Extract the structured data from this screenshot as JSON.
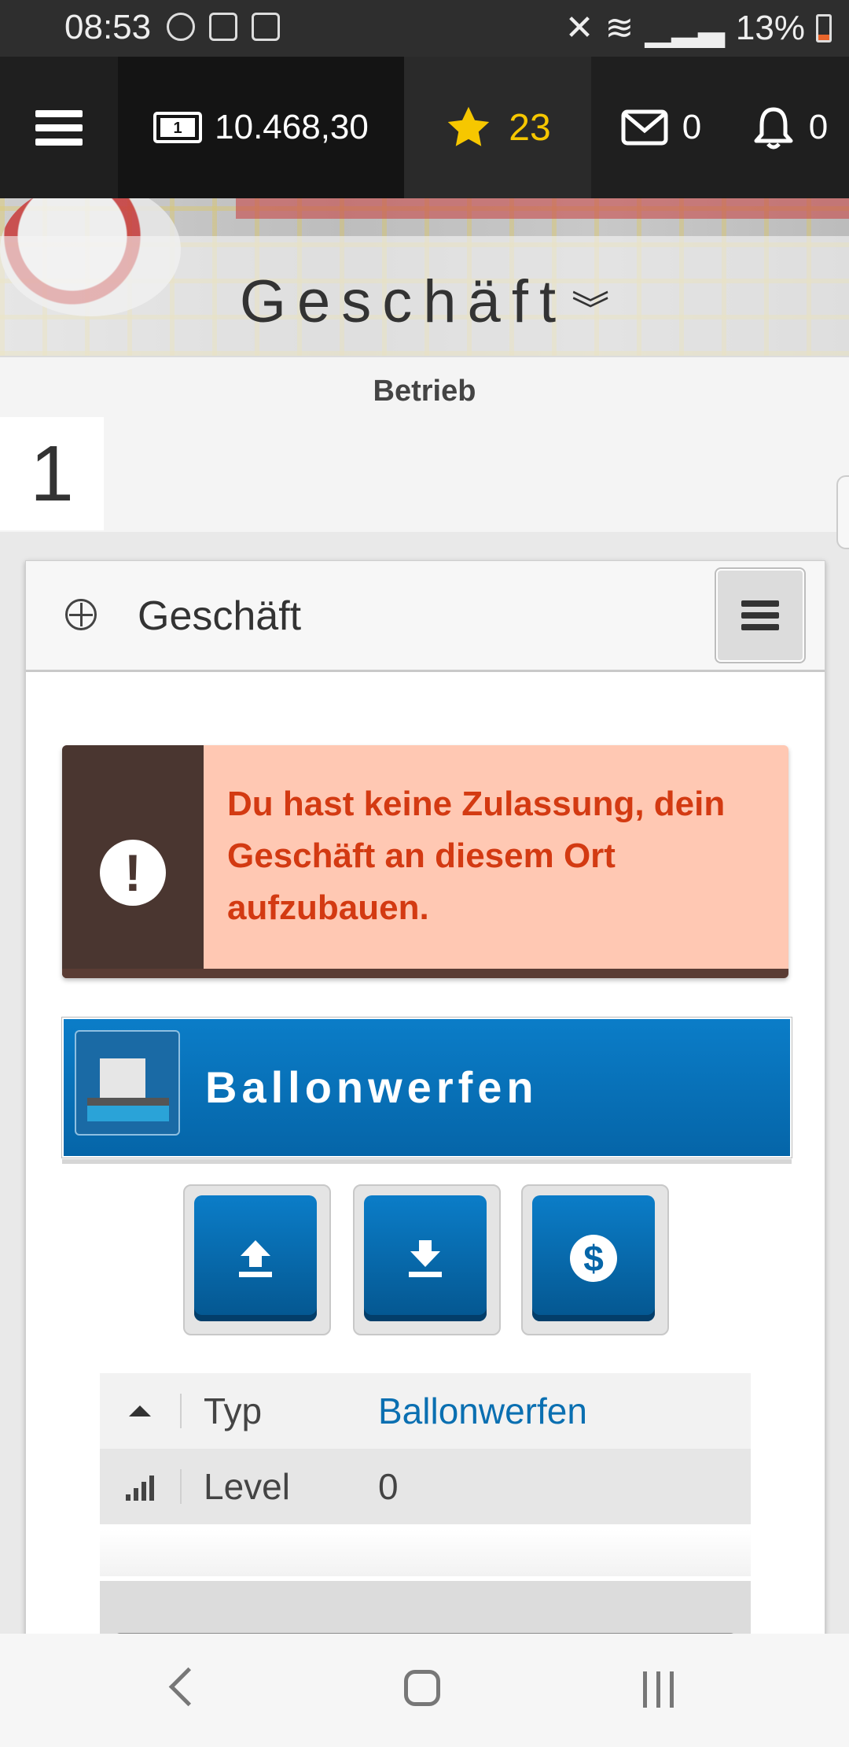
{
  "status_bar": {
    "time": "08:53",
    "battery": "13%",
    "icons": [
      "sync-icon",
      "screen-icon",
      "check-icon",
      "mute-icon",
      "wifi-icon",
      "signal-icon",
      "battery-icon"
    ]
  },
  "header": {
    "money": "10.468,30",
    "stars": "23",
    "messages": "0",
    "notifications": "0",
    "colors": {
      "background": "#1f1f1f",
      "star": "#f6c700"
    }
  },
  "banner": {
    "title": "Geschäft"
  },
  "subnav": {
    "label": "Betrieb",
    "number": "1"
  },
  "panel": {
    "title": "Geschäft",
    "alert": {
      "message": "Du hast keine Zulassung, dein Geschäft an diesem Ort aufzubauen.",
      "color": "#d33a12",
      "background": "#ffc8b3"
    },
    "business": {
      "name": "Ballonwerfen",
      "color": "#0565a8",
      "actions": [
        "upload-icon",
        "download-icon",
        "dollar-icon"
      ]
    },
    "info": [
      {
        "icon": "triangle-up-icon",
        "key": "Typ",
        "value": "Ballonwerfen"
      },
      {
        "icon": "signal-bars-icon",
        "key": "Level",
        "value": "0"
      }
    ]
  }
}
